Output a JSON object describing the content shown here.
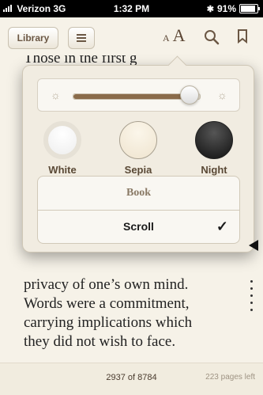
{
  "status": {
    "carrier": "Verizon",
    "network": "3G",
    "time": "1:32 PM",
    "battery": "91%"
  },
  "toolbar": {
    "library_label": "Library",
    "aa_small": "A",
    "aa_big": "A"
  },
  "book": {
    "top_fragment": "Those in the first g",
    "lines": [
      "privacy of one’s own mind.",
      "Words were a commitment,",
      "carrying implications which",
      "they did not wish to face."
    ]
  },
  "popover": {
    "brightness_level": 0.92,
    "themes": [
      {
        "label": "White",
        "color": "#ffffff",
        "selected": true
      },
      {
        "label": "Sepia",
        "color": "#f3ead6",
        "selected": false
      },
      {
        "label": "Night",
        "color": "#1a1a1a",
        "selected": false
      }
    ],
    "modes": {
      "book_label": "Book",
      "scroll_label": "Scroll",
      "selected_mark": "✓"
    }
  },
  "footer": {
    "page_progress": "2937 of 8784",
    "pages_left": "223 pages left"
  },
  "colors": {
    "accent_brown": "#6b5744",
    "slider_fill": "#8a6b4a",
    "background": "#f6f2e8"
  }
}
